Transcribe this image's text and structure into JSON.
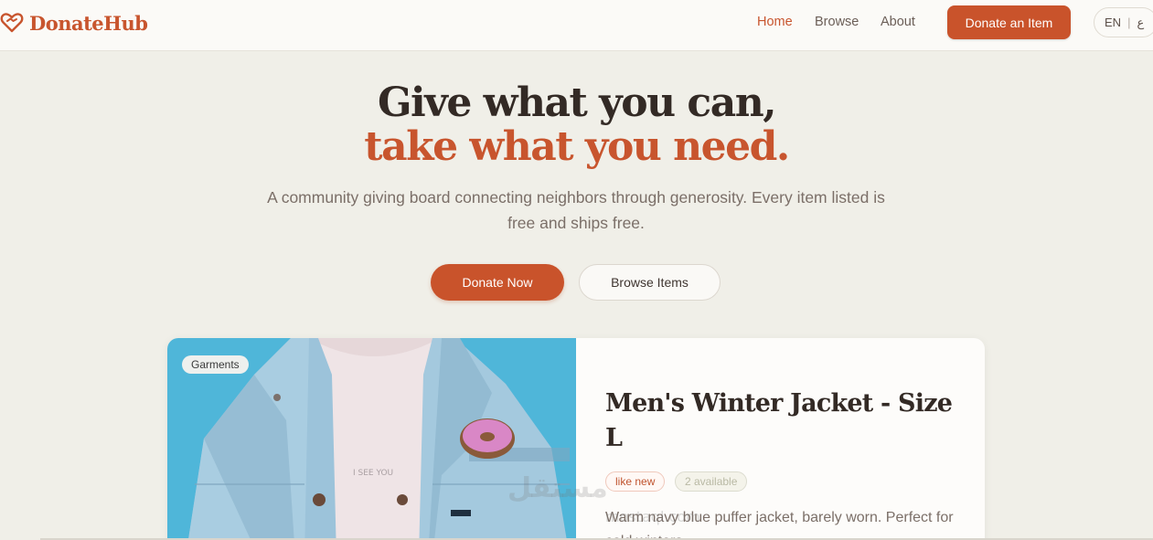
{
  "brand": {
    "name": "DonateHub",
    "color": "#c8552e",
    "icon": "heart-handshake-icon"
  },
  "nav": {
    "links": [
      {
        "label": "Home",
        "active": true
      },
      {
        "label": "Browse",
        "active": false
      },
      {
        "label": "About",
        "active": false
      }
    ],
    "donate_label": "Donate an Item",
    "lang": {
      "en": "EN",
      "sep": "|",
      "ar": "ع"
    }
  },
  "hero": {
    "title_line1": "Give what you can,",
    "title_line2": "take what you need.",
    "subtitle": "A community giving board connecting neighbors through generosity. Every item listed is free and ships free.",
    "primary_label": "Donate Now",
    "secondary_label": "Browse Items"
  },
  "card": {
    "category": "Garments",
    "title": "Men's Winter Jacket - Size L",
    "condition": "like new",
    "availability": "2 available",
    "description": "Warm navy blue puffer jacket, barely worn. Perfect for cold winters."
  },
  "watermark": {
    "line1": "مستقل",
    "line2": "mostaql.com"
  },
  "colors": {
    "accent": "#c9532b",
    "background": "#f0efe8",
    "nav_bg": "#fbfaf7",
    "heading": "#332a25",
    "text_muted": "#7b6f68"
  }
}
